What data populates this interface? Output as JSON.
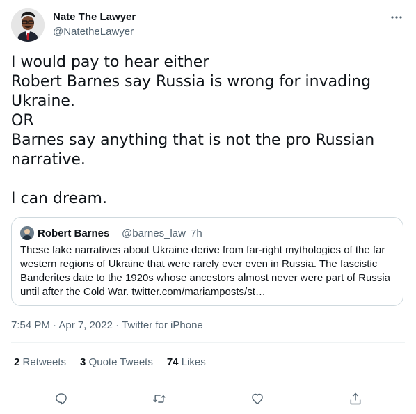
{
  "author": {
    "name": "Nate The Lawyer",
    "handle": "@NatetheLawyer"
  },
  "tweet": {
    "lines": [
      "I would pay to hear either",
      "Robert Barnes say Russia is wrong for invading",
      "Ukraine.",
      "OR",
      "Barnes say anything that is not the pro Russian",
      "narrative.",
      "",
      "I can dream."
    ]
  },
  "quoted": {
    "name": "Robert Barnes",
    "handle": "@barnes_law",
    "separator": "·",
    "time": "7h",
    "text": "These fake narratives about Ukraine derive from far-right mythologies of the far western regions of Ukraine that were rarely ever even in Russia. The fascistic Banderites date to the 1920s whose ancestors almost never were part of Russia until after the Cold War. twitter.com/mariamposts/st…"
  },
  "meta": {
    "time": "7:54 PM",
    "dot1": "·",
    "date": "Apr 7, 2022",
    "dot2": "·",
    "source": "Twitter for iPhone"
  },
  "stats": {
    "retweets_count": "2",
    "retweets_label": "Retweets",
    "quotes_count": "3",
    "quotes_label": "Quote Tweets",
    "likes_count": "74",
    "likes_label": "Likes"
  },
  "icons": {
    "more": "more-horizontal-icon",
    "reply": "reply-icon",
    "retweet": "retweet-icon",
    "like": "heart-icon",
    "share": "share-icon"
  },
  "colors": {
    "text": "#0f1419",
    "secondary": "#536471",
    "border": "#cfd9de",
    "divider": "#eff3f4"
  }
}
